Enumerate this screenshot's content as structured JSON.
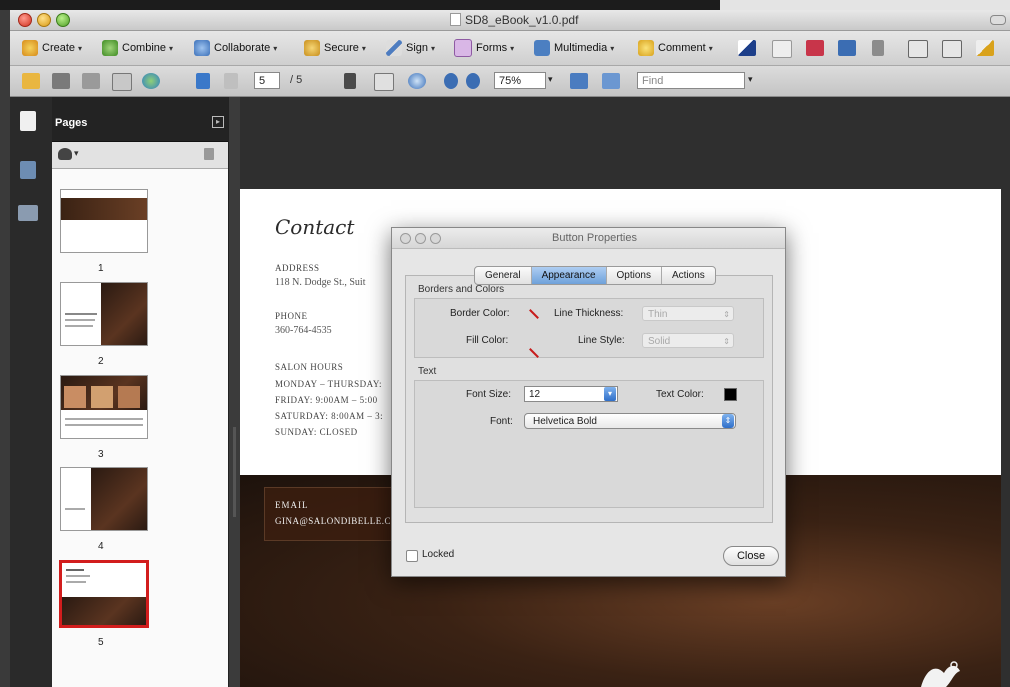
{
  "window": {
    "title": "SD8_eBook_v1.0.pdf"
  },
  "toolbar": {
    "create": "Create",
    "combine": "Combine",
    "collaborate": "Collaborate",
    "secure": "Secure",
    "sign": "Sign",
    "forms": "Forms",
    "multimedia": "Multimedia",
    "comment": "Comment"
  },
  "nav": {
    "current_page": "5",
    "page_total": "/ 5",
    "zoom": "75%",
    "find_placeholder": "Find"
  },
  "pages_panel": {
    "title": "Pages",
    "thumbnails": [
      {
        "label": "1"
      },
      {
        "label": "2"
      },
      {
        "label": "3"
      },
      {
        "label": "4"
      },
      {
        "label": "5",
        "selected": true
      }
    ]
  },
  "document": {
    "heading": "Contact",
    "address_label": "Address",
    "address_value": "118 N. Dodge St., Suit",
    "phone_label": "Phone",
    "phone_value": "360-764-4535",
    "hours_label": "Salon Hours",
    "hours": [
      "Monday – Thursday:",
      "Friday: 9:00am – 5:00",
      "Saturday: 8:00am – 3:",
      "Sunday: Closed"
    ],
    "email_label": "Email",
    "email_value": "gina@salondibelle.c"
  },
  "dialog": {
    "title": "Button Properties",
    "tabs": [
      {
        "label": "General",
        "active": false
      },
      {
        "label": "Appearance",
        "active": true
      },
      {
        "label": "Options",
        "active": false
      },
      {
        "label": "Actions",
        "active": false
      }
    ],
    "borders_section": "Borders and Colors",
    "border_color_label": "Border Color:",
    "fill_color_label": "Fill Color:",
    "line_thickness_label": "Line Thickness:",
    "line_thickness_value": "Thin",
    "line_style_label": "Line Style:",
    "line_style_value": "Solid",
    "text_section": "Text",
    "font_size_label": "Font Size:",
    "font_size_value": "12",
    "text_color_label": "Text Color:",
    "font_label": "Font:",
    "font_value": "Helvetica Bold",
    "locked_label": "Locked",
    "close_label": "Close"
  },
  "colors": {
    "accent_red": "#d21d1d",
    "tab_blue": "#6ea1da",
    "doc_brown": "#3a2214"
  }
}
